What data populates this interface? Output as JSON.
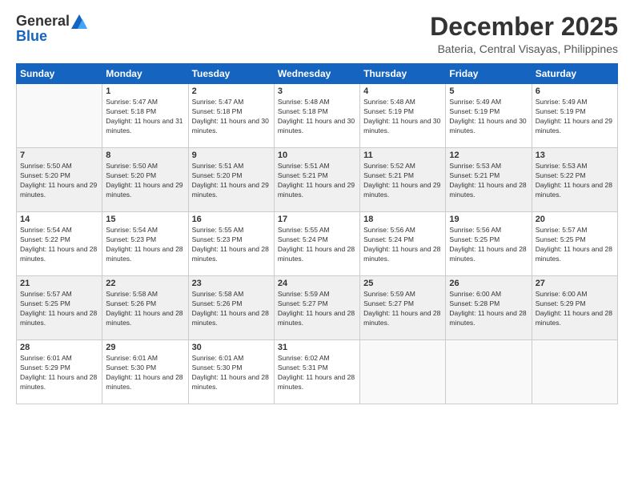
{
  "logo": {
    "general": "General",
    "blue": "Blue"
  },
  "title": "December 2025",
  "location": "Bateria, Central Visayas, Philippines",
  "weekdays": [
    "Sunday",
    "Monday",
    "Tuesday",
    "Wednesday",
    "Thursday",
    "Friday",
    "Saturday"
  ],
  "weeks": [
    [
      {
        "day": "",
        "empty": true
      },
      {
        "day": "1",
        "sunrise": "Sunrise: 5:47 AM",
        "sunset": "Sunset: 5:18 PM",
        "daylight": "Daylight: 11 hours and 31 minutes."
      },
      {
        "day": "2",
        "sunrise": "Sunrise: 5:47 AM",
        "sunset": "Sunset: 5:18 PM",
        "daylight": "Daylight: 11 hours and 30 minutes."
      },
      {
        "day": "3",
        "sunrise": "Sunrise: 5:48 AM",
        "sunset": "Sunset: 5:18 PM",
        "daylight": "Daylight: 11 hours and 30 minutes."
      },
      {
        "day": "4",
        "sunrise": "Sunrise: 5:48 AM",
        "sunset": "Sunset: 5:19 PM",
        "daylight": "Daylight: 11 hours and 30 minutes."
      },
      {
        "day": "5",
        "sunrise": "Sunrise: 5:49 AM",
        "sunset": "Sunset: 5:19 PM",
        "daylight": "Daylight: 11 hours and 30 minutes."
      },
      {
        "day": "6",
        "sunrise": "Sunrise: 5:49 AM",
        "sunset": "Sunset: 5:19 PM",
        "daylight": "Daylight: 11 hours and 29 minutes."
      }
    ],
    [
      {
        "day": "7",
        "sunrise": "Sunrise: 5:50 AM",
        "sunset": "Sunset: 5:20 PM",
        "daylight": "Daylight: 11 hours and 29 minutes."
      },
      {
        "day": "8",
        "sunrise": "Sunrise: 5:50 AM",
        "sunset": "Sunset: 5:20 PM",
        "daylight": "Daylight: 11 hours and 29 minutes."
      },
      {
        "day": "9",
        "sunrise": "Sunrise: 5:51 AM",
        "sunset": "Sunset: 5:20 PM",
        "daylight": "Daylight: 11 hours and 29 minutes."
      },
      {
        "day": "10",
        "sunrise": "Sunrise: 5:51 AM",
        "sunset": "Sunset: 5:21 PM",
        "daylight": "Daylight: 11 hours and 29 minutes."
      },
      {
        "day": "11",
        "sunrise": "Sunrise: 5:52 AM",
        "sunset": "Sunset: 5:21 PM",
        "daylight": "Daylight: 11 hours and 29 minutes."
      },
      {
        "day": "12",
        "sunrise": "Sunrise: 5:53 AM",
        "sunset": "Sunset: 5:21 PM",
        "daylight": "Daylight: 11 hours and 28 minutes."
      },
      {
        "day": "13",
        "sunrise": "Sunrise: 5:53 AM",
        "sunset": "Sunset: 5:22 PM",
        "daylight": "Daylight: 11 hours and 28 minutes."
      }
    ],
    [
      {
        "day": "14",
        "sunrise": "Sunrise: 5:54 AM",
        "sunset": "Sunset: 5:22 PM",
        "daylight": "Daylight: 11 hours and 28 minutes."
      },
      {
        "day": "15",
        "sunrise": "Sunrise: 5:54 AM",
        "sunset": "Sunset: 5:23 PM",
        "daylight": "Daylight: 11 hours and 28 minutes."
      },
      {
        "day": "16",
        "sunrise": "Sunrise: 5:55 AM",
        "sunset": "Sunset: 5:23 PM",
        "daylight": "Daylight: 11 hours and 28 minutes."
      },
      {
        "day": "17",
        "sunrise": "Sunrise: 5:55 AM",
        "sunset": "Sunset: 5:24 PM",
        "daylight": "Daylight: 11 hours and 28 minutes."
      },
      {
        "day": "18",
        "sunrise": "Sunrise: 5:56 AM",
        "sunset": "Sunset: 5:24 PM",
        "daylight": "Daylight: 11 hours and 28 minutes."
      },
      {
        "day": "19",
        "sunrise": "Sunrise: 5:56 AM",
        "sunset": "Sunset: 5:25 PM",
        "daylight": "Daylight: 11 hours and 28 minutes."
      },
      {
        "day": "20",
        "sunrise": "Sunrise: 5:57 AM",
        "sunset": "Sunset: 5:25 PM",
        "daylight": "Daylight: 11 hours and 28 minutes."
      }
    ],
    [
      {
        "day": "21",
        "sunrise": "Sunrise: 5:57 AM",
        "sunset": "Sunset: 5:25 PM",
        "daylight": "Daylight: 11 hours and 28 minutes."
      },
      {
        "day": "22",
        "sunrise": "Sunrise: 5:58 AM",
        "sunset": "Sunset: 5:26 PM",
        "daylight": "Daylight: 11 hours and 28 minutes."
      },
      {
        "day": "23",
        "sunrise": "Sunrise: 5:58 AM",
        "sunset": "Sunset: 5:26 PM",
        "daylight": "Daylight: 11 hours and 28 minutes."
      },
      {
        "day": "24",
        "sunrise": "Sunrise: 5:59 AM",
        "sunset": "Sunset: 5:27 PM",
        "daylight": "Daylight: 11 hours and 28 minutes."
      },
      {
        "day": "25",
        "sunrise": "Sunrise: 5:59 AM",
        "sunset": "Sunset: 5:27 PM",
        "daylight": "Daylight: 11 hours and 28 minutes."
      },
      {
        "day": "26",
        "sunrise": "Sunrise: 6:00 AM",
        "sunset": "Sunset: 5:28 PM",
        "daylight": "Daylight: 11 hours and 28 minutes."
      },
      {
        "day": "27",
        "sunrise": "Sunrise: 6:00 AM",
        "sunset": "Sunset: 5:29 PM",
        "daylight": "Daylight: 11 hours and 28 minutes."
      }
    ],
    [
      {
        "day": "28",
        "sunrise": "Sunrise: 6:01 AM",
        "sunset": "Sunset: 5:29 PM",
        "daylight": "Daylight: 11 hours and 28 minutes."
      },
      {
        "day": "29",
        "sunrise": "Sunrise: 6:01 AM",
        "sunset": "Sunset: 5:30 PM",
        "daylight": "Daylight: 11 hours and 28 minutes."
      },
      {
        "day": "30",
        "sunrise": "Sunrise: 6:01 AM",
        "sunset": "Sunset: 5:30 PM",
        "daylight": "Daylight: 11 hours and 28 minutes."
      },
      {
        "day": "31",
        "sunrise": "Sunrise: 6:02 AM",
        "sunset": "Sunset: 5:31 PM",
        "daylight": "Daylight: 11 hours and 28 minutes."
      },
      {
        "day": "",
        "empty": true
      },
      {
        "day": "",
        "empty": true
      },
      {
        "day": "",
        "empty": true
      }
    ]
  ]
}
